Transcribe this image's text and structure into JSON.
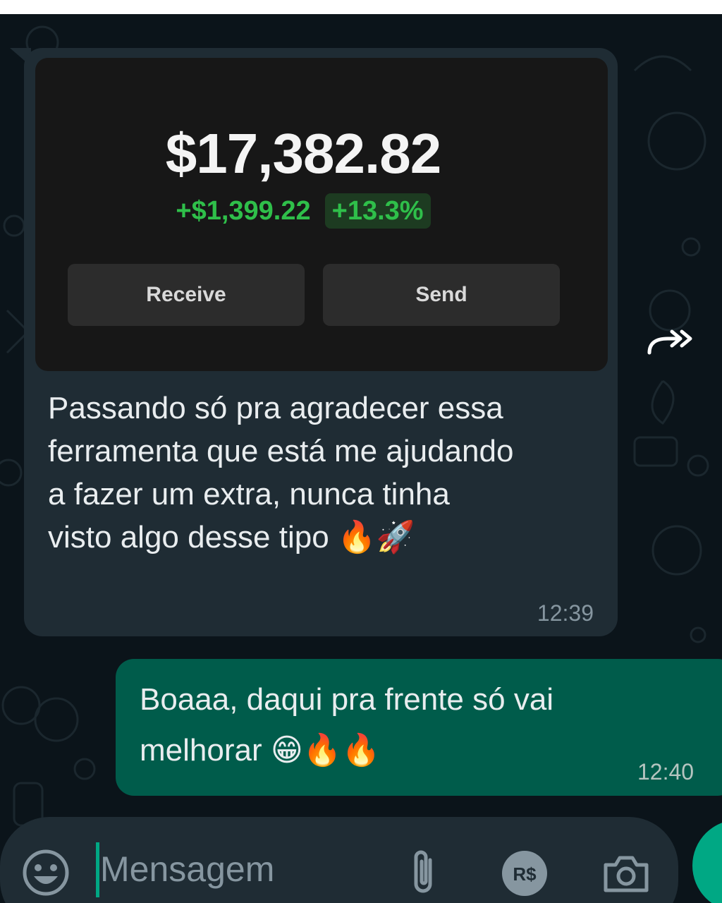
{
  "chat": {
    "incoming": {
      "screenshot": {
        "balance": "$17,382.82",
        "change_amount": "+$1,399.22",
        "change_percent": "+13.3%",
        "receive_label": "Receive",
        "send_label": "Send"
      },
      "text_lines": [
        "Passando só pra agradecer essa",
        "ferramenta que está me ajudando",
        "a fazer um extra, nunca tinha",
        "visto algo desse tipo 🔥🚀"
      ],
      "time": "12:39"
    },
    "outgoing": {
      "text_lines": [
        "Boaaa, daqui pra frente só vai",
        "melhorar 😁🔥🔥"
      ],
      "time": "12:40"
    }
  },
  "composer": {
    "placeholder": "Mensagem"
  },
  "icons": {
    "forward": "forward-icon",
    "emoji": "emoji-icon",
    "attach": "paperclip-icon",
    "payment": "payment-icon",
    "camera": "camera-icon",
    "mic": "mic-icon"
  },
  "colors": {
    "background": "#0b141a",
    "incoming_bubble": "#1f2c34",
    "outgoing_bubble": "#005c4b",
    "accent": "#00a884",
    "gain": "#2fbf4a"
  }
}
